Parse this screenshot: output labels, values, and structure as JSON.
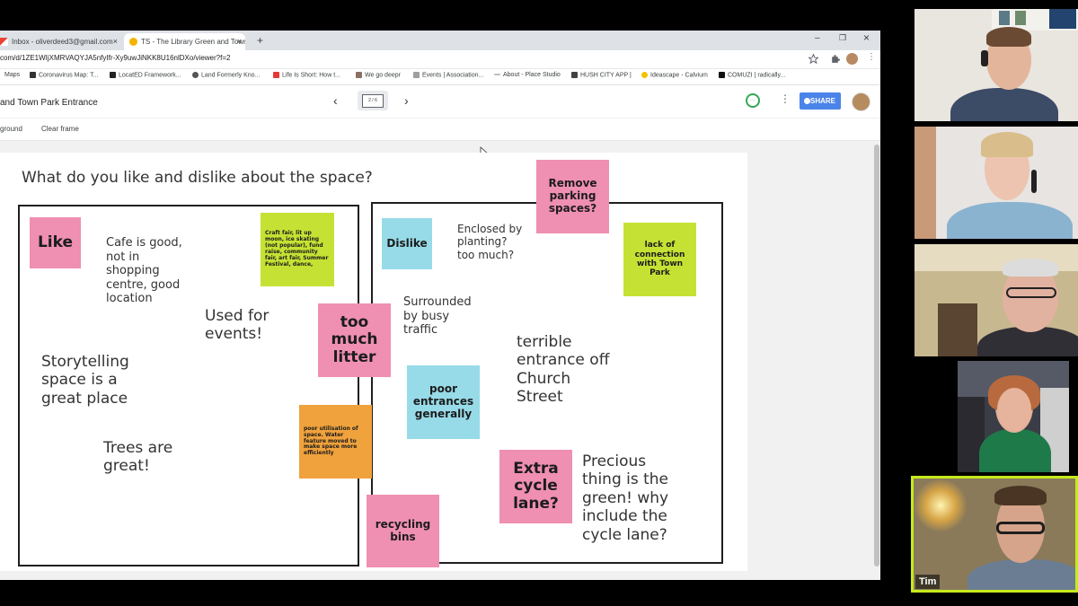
{
  "browser": {
    "tabs": [
      {
        "label": "Inbox - oliverdeed3@gmail.com",
        "close": "×"
      },
      {
        "label": "TS - The Library Green and Town",
        "close": "×"
      }
    ],
    "new_tab": "+",
    "window_controls": {
      "minimize": "–",
      "maximize": "❐",
      "close": "×"
    },
    "url": "com/d/1ZE1WIjXMRVAQYJA5nfyIfr-Xy9uwJiNKK8U16nlDXo/viewer?f=2",
    "bookmarks": [
      "Maps",
      "Coronavirus Map: T...",
      "LocatED Framework...",
      "Land Formerly Kno...",
      "Life Is Short: How t...",
      "We go deepr",
      "Events | Association...",
      "About - Place Studio",
      "HUSH CITY APP |",
      "Ideascape - Calvium",
      "COMUZI | radically..."
    ]
  },
  "app": {
    "title": "and Town Park Entrance",
    "frame_counter": "2 / 6",
    "share_label": "SHARE",
    "subtoolbar": {
      "background": "ground",
      "clear": "Clear frame"
    }
  },
  "board": {
    "question": "What do you like and dislike about the space?",
    "stickies": {
      "like": "Like",
      "dislike": "Dislike",
      "remove_parking": "Remove parking spaces?",
      "lack_connection": "lack of connection with Town Park",
      "craft_fair": "Craft fair, lit up moon, ice skating (not popular), fund raise, community fair, art fair, Summer Festival, dance,",
      "too_much_litter": "too much litter",
      "poor_entrances": "poor entrances generally",
      "poor_utilisation": "poor utilisation of space. Water feature moved to make space more efficiently",
      "extra_cycle": "Extra cycle lane?",
      "recycling": "recycling bins"
    },
    "texts": {
      "cafe": "Cafe  is good, not in shopping centre, good location",
      "used_events": "Used for events!",
      "storytelling": "Storytelling space is a great place",
      "trees": "Trees are great!",
      "enclosed": "Enclosed by planting? too much?",
      "surrounded": "Surrounded by busy traffic",
      "terrible": "terrible entrance off Church Street",
      "precious": "Precious thing is the green! why include the cycle lane?"
    }
  },
  "participants": [
    {
      "name": ""
    },
    {
      "name": ""
    },
    {
      "name": ""
    },
    {
      "name": ""
    },
    {
      "name": "Tim",
      "active": true
    }
  ],
  "colors": {
    "pink": "#ef8fb2",
    "green": "#c5e234",
    "blue": "#97dbe8",
    "orange": "#f0a23c",
    "share_button": "#4a84e8",
    "active_speaker": "#c6ea1b"
  }
}
